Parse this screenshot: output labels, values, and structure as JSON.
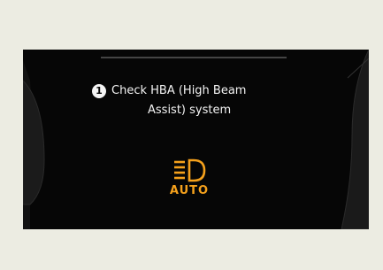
{
  "message": {
    "badge": "1",
    "line1": "Check HBA (High Beam",
    "line2": "Assist) system"
  },
  "indicator": {
    "icon": "high-beam-assist-icon",
    "label": "AUTO"
  },
  "colors": {
    "background": "#ecece2",
    "screen": "#060606",
    "text": "#f4f4f4",
    "indicator": "#f5a11c"
  }
}
